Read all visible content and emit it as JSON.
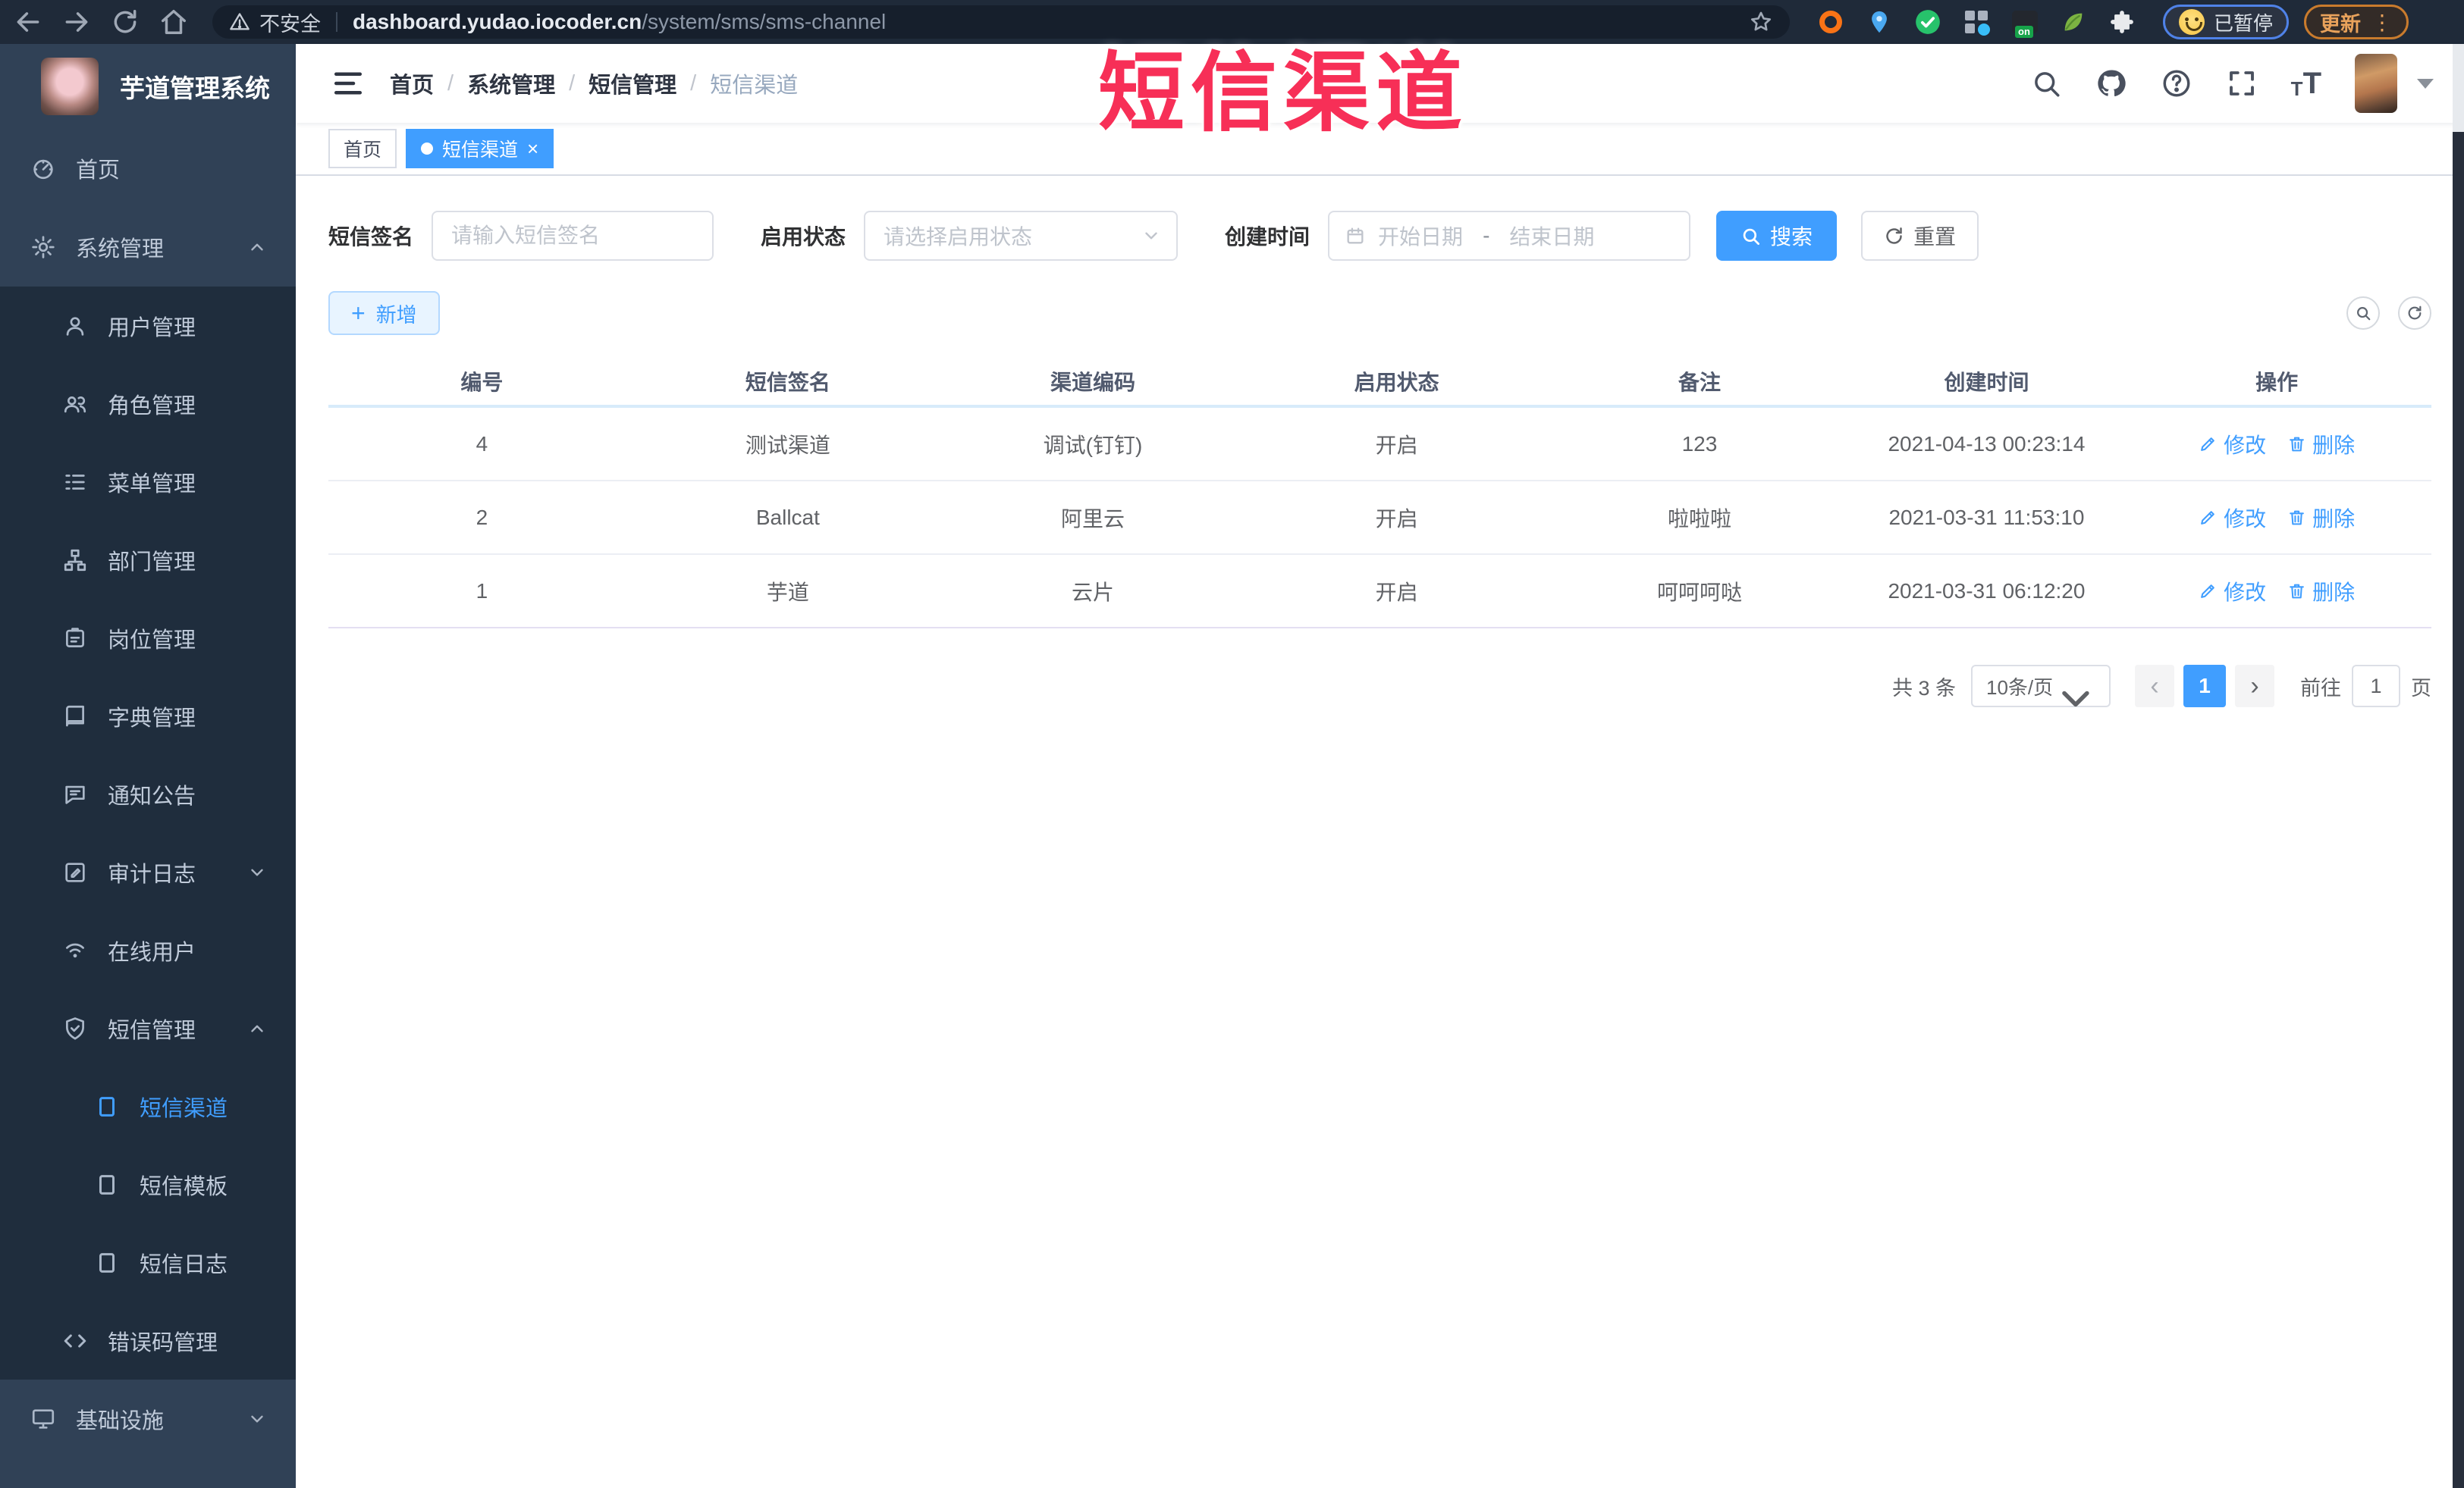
{
  "browser": {
    "security_label": "不安全",
    "url_host": "dashboard.yudao.iocoder.cn",
    "url_path": "/system/sms/sms-channel",
    "paused_label": "已暂停",
    "update_label": "更新",
    "update_dots": "⋮",
    "on_badge": "on"
  },
  "overlay_title": "短信渠道",
  "sidebar": {
    "app_title": "芋道管理系统",
    "items": [
      {
        "label": "首页",
        "icon": "dashboard-icon",
        "level": 1
      },
      {
        "label": "系统管理",
        "icon": "gear-icon",
        "level": 1,
        "arrow": "up"
      },
      {
        "label": "用户管理",
        "icon": "user-icon",
        "level": 2
      },
      {
        "label": "角色管理",
        "icon": "users-icon",
        "level": 2
      },
      {
        "label": "菜单管理",
        "icon": "menu-list-icon",
        "level": 2
      },
      {
        "label": "部门管理",
        "icon": "org-tree-icon",
        "level": 2
      },
      {
        "label": "岗位管理",
        "icon": "badge-icon",
        "level": 2
      },
      {
        "label": "字典管理",
        "icon": "book-icon",
        "level": 2
      },
      {
        "label": "通知公告",
        "icon": "announcement-icon",
        "level": 2
      },
      {
        "label": "审计日志",
        "icon": "audit-icon",
        "level": 2,
        "arrow": "down"
      },
      {
        "label": "在线用户",
        "icon": "online-icon",
        "level": 2
      },
      {
        "label": "短信管理",
        "icon": "sms-shield-icon",
        "level": 2,
        "arrow": "up"
      },
      {
        "label": "短信渠道",
        "icon": "doc-icon",
        "level": 3,
        "active": true
      },
      {
        "label": "短信模板",
        "icon": "doc-icon",
        "level": 3
      },
      {
        "label": "短信日志",
        "icon": "doc-icon",
        "level": 3
      },
      {
        "label": "错误码管理",
        "icon": "code-icon",
        "level": 2
      },
      {
        "label": "基础设施",
        "icon": "monitor-icon",
        "level": 1,
        "arrow": "down"
      }
    ]
  },
  "navbar": {
    "breadcrumb": [
      "首页",
      "系统管理",
      "短信管理",
      "短信渠道"
    ],
    "separator": "/"
  },
  "tabs": [
    {
      "label": "首页",
      "active": false,
      "closable": false
    },
    {
      "label": "短信渠道",
      "active": true,
      "closable": true
    }
  ],
  "glyphs": {
    "close": "×",
    "plus": "+",
    "prev": "‹",
    "next": "›"
  },
  "filters": {
    "sign_label": "短信签名",
    "sign_placeholder": "请输入短信签名",
    "status_label": "启用状态",
    "status_placeholder": "请选择启用状态",
    "time_label": "创建时间",
    "start_placeholder": "开始日期",
    "range_separator": "-",
    "end_placeholder": "结束日期",
    "search_label": "搜索",
    "reset_label": "重置"
  },
  "toolbar": {
    "add_label": "新增"
  },
  "table": {
    "columns": [
      "编号",
      "短信签名",
      "渠道编码",
      "启用状态",
      "备注",
      "创建时间",
      "操作"
    ],
    "edit_label": "修改",
    "delete_label": "删除",
    "rows": [
      {
        "id": "4",
        "sign": "测试渠道",
        "code": "调试(钉钉)",
        "status": "开启",
        "remark": "123",
        "created": "2021-04-13 00:23:14"
      },
      {
        "id": "2",
        "sign": "Ballcat",
        "code": "阿里云",
        "status": "开启",
        "remark": "啦啦啦",
        "created": "2021-03-31 11:53:10"
      },
      {
        "id": "1",
        "sign": "芋道",
        "code": "云片",
        "status": "开启",
        "remark": "呵呵呵哒",
        "created": "2021-03-31 06:12:20"
      }
    ]
  },
  "pagination": {
    "total_label": "共 3 条",
    "page_size": "10条/页",
    "current_page": "1",
    "goto_label": "前往",
    "goto_value": "1",
    "page_label": "页"
  },
  "colors": {
    "accent_blue": "#409eff",
    "sidebar_bg": "#304156",
    "submenu_bg": "#1f2d3d",
    "chrome_bg": "#1f2a39",
    "annotation_red": "#f72f57"
  }
}
